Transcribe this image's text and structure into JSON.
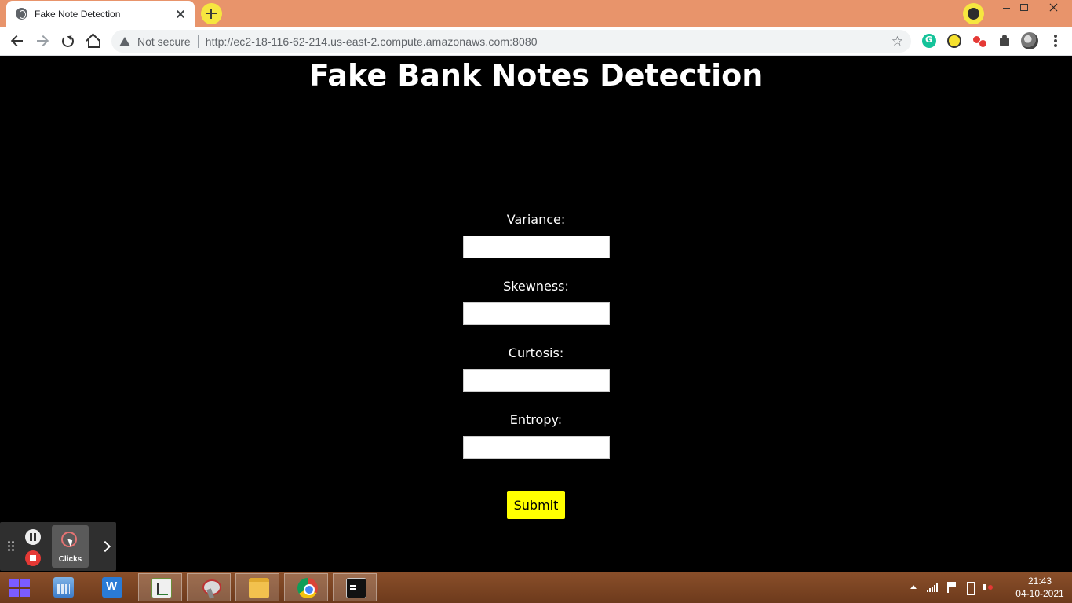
{
  "browser": {
    "tab_title": "Fake Note Detection",
    "security_label": "Not secure",
    "url": "http://ec2-18-116-62-214.us-east-2.compute.amazonaws.com:8080",
    "star_icon": "☆"
  },
  "page": {
    "title": "Fake Bank Notes Detection",
    "fields": [
      {
        "label": "Variance:",
        "value": "",
        "placeholder": ""
      },
      {
        "label": "Skewness:",
        "value": "",
        "placeholder": ""
      },
      {
        "label": "Curtosis:",
        "value": "",
        "placeholder": ""
      },
      {
        "label": "Entropy:",
        "value": "",
        "placeholder": ""
      }
    ],
    "submit_label": "Submit"
  },
  "recorder": {
    "clicks_label": "Clicks"
  },
  "taskbar": {
    "apps": [
      "calculator-icon",
      "wps-writer-icon",
      "notepad-plus-icon",
      "snipping-tool-icon",
      "file-explorer-icon",
      "chrome-icon",
      "command-prompt-icon"
    ],
    "clock_time": "21:43",
    "clock_date": "04-10-2021"
  },
  "colors": {
    "titlebar": "#e8946b",
    "page_background": "#000000",
    "submit_button": "#ffff00",
    "taskbar": "#8a4f2a"
  }
}
